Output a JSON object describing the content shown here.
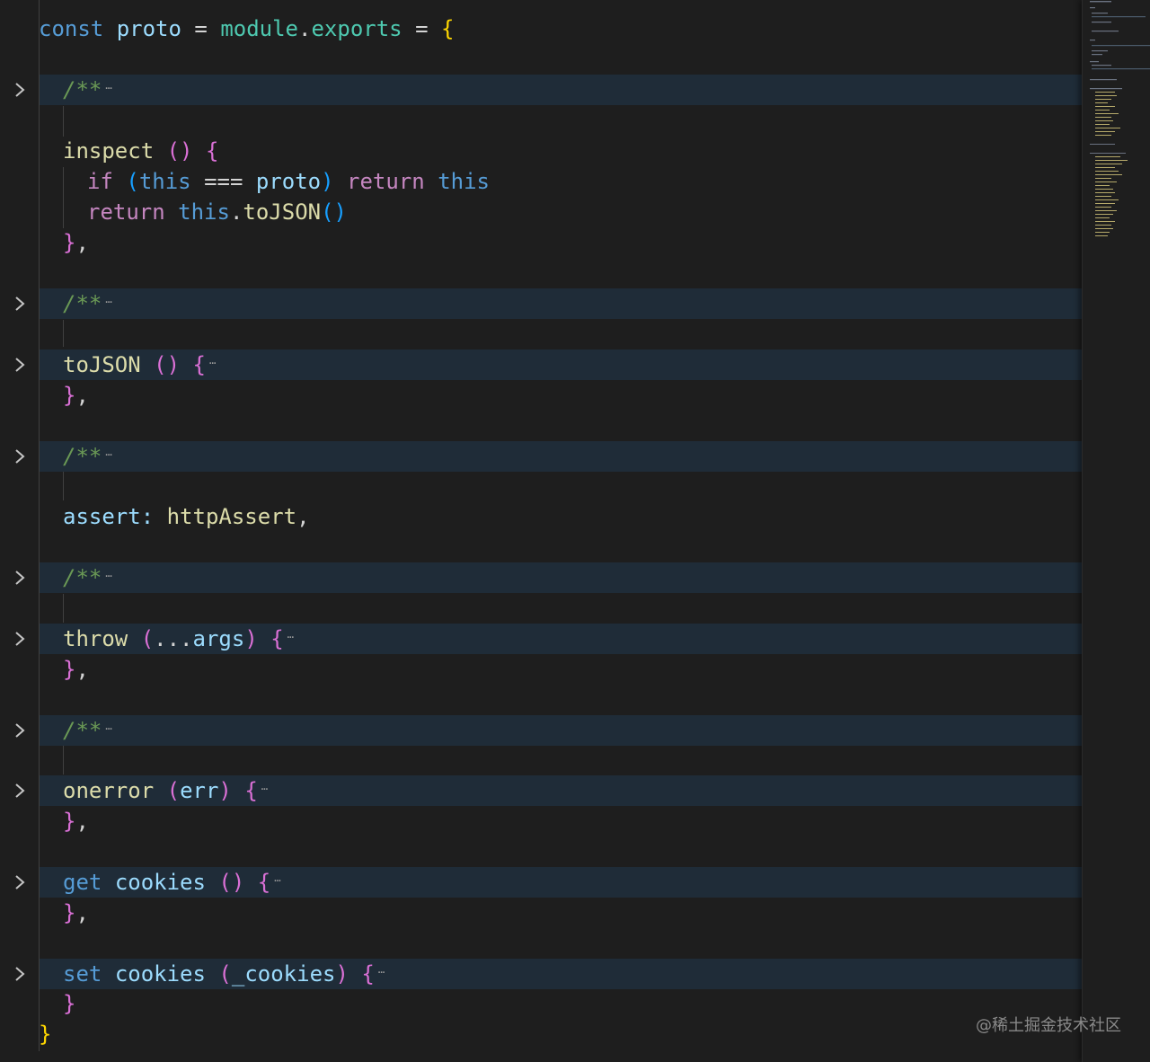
{
  "editor": {
    "language": "javascript",
    "collapsed_ellipsis": "⋯",
    "fold_icon": "chevron-right-icon",
    "lines": {
      "l1": {
        "t1": "const",
        "t2": "proto",
        "t3": "=",
        "t4": "module",
        "t5": ".",
        "t6": "exports",
        "t7": "=",
        "t8": "{"
      },
      "l2": {
        "t1": "/**"
      },
      "l3": {
        "t1": "inspect",
        "t2": "()",
        "t3": "{"
      },
      "l4": {
        "t1": "if",
        "t2": "(",
        "t3": "this",
        "t4": "===",
        "t5": "proto",
        "t6": ")",
        "t7": "return",
        "t8": "this"
      },
      "l5": {
        "t1": "return",
        "t2": "this",
        "t3": ".",
        "t4": "toJSON",
        "t5": "()"
      },
      "l6": {
        "t1": "}",
        "t2": ","
      },
      "l7": {
        "t1": "/**"
      },
      "l8": {
        "t1": "toJSON",
        "t2": "()",
        "t3": "{"
      },
      "l9": {
        "t1": "}",
        "t2": ","
      },
      "l10": {
        "t1": "/**"
      },
      "l11": {
        "t1": "assert",
        "t2": ":",
        "t3": "httpAssert",
        "t4": ","
      },
      "l12": {
        "t1": "/**"
      },
      "l13": {
        "t1": "throw",
        "t2": "(",
        "t3": "...",
        "t4": "args",
        "t5": ")",
        "t6": "{"
      },
      "l14": {
        "t1": "}",
        "t2": ","
      },
      "l15": {
        "t1": "/**"
      },
      "l16": {
        "t1": "onerror",
        "t2": "(",
        "t3": "err",
        "t4": ")",
        "t5": "{"
      },
      "l17": {
        "t1": "}",
        "t2": ","
      },
      "l18": {
        "t1": "get",
        "t2": "cookies",
        "t3": "()",
        "t4": "{"
      },
      "l19": {
        "t1": "}",
        "t2": ","
      },
      "l20": {
        "t1": "set",
        "t2": "cookies",
        "t3": "(",
        "t4": "_cookies",
        "t5": ")",
        "t6": "{"
      },
      "l21": {
        "t1": "}"
      },
      "l22": {
        "t1": "}"
      }
    }
  },
  "watermark": "@稀土掘金技术社区"
}
